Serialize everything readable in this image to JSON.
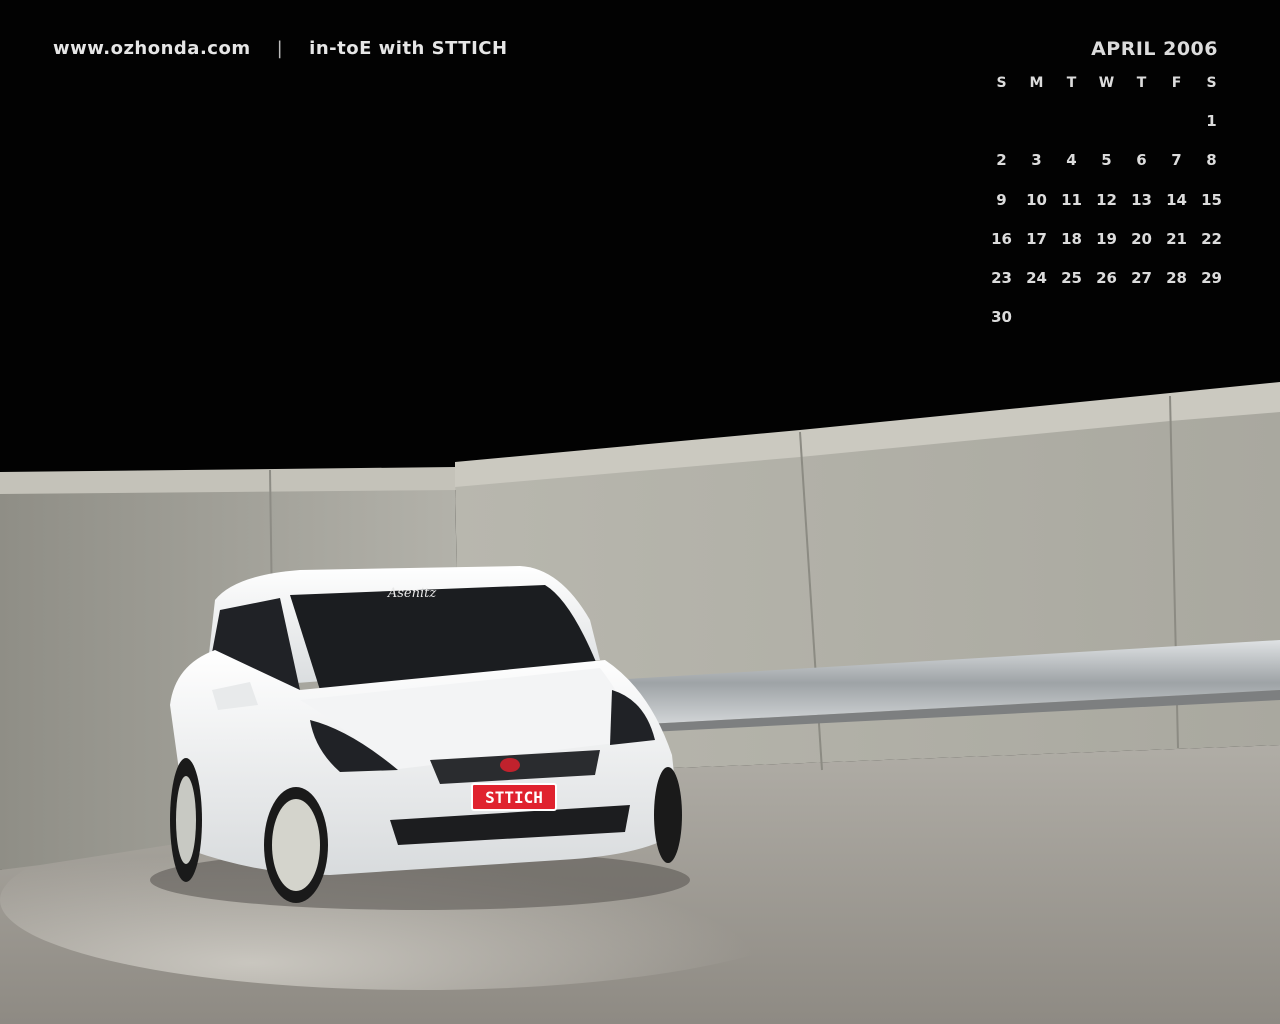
{
  "header": {
    "site": "www.ozhonda.com",
    "separator": "|",
    "subtitle": "in-toE with STTICH"
  },
  "calendar": {
    "title": "APRIL 2006",
    "weekdays": [
      "S",
      "M",
      "T",
      "W",
      "T",
      "F",
      "S"
    ],
    "first_weekday_index": 6,
    "days": [
      "1",
      "2",
      "3",
      "4",
      "5",
      "6",
      "7",
      "8",
      "9",
      "10",
      "11",
      "12",
      "13",
      "14",
      "15",
      "16",
      "17",
      "18",
      "19",
      "20",
      "21",
      "22",
      "23",
      "24",
      "25",
      "26",
      "27",
      "28",
      "29",
      "30"
    ]
  },
  "photo": {
    "plate": "STTICH",
    "windshield_banner": "Asenitz",
    "colors": {
      "sky": "#020202",
      "wall": "#a9a89f",
      "ground": "#a39f98",
      "car": "#eceeef",
      "plate": "#e0222e"
    }
  }
}
